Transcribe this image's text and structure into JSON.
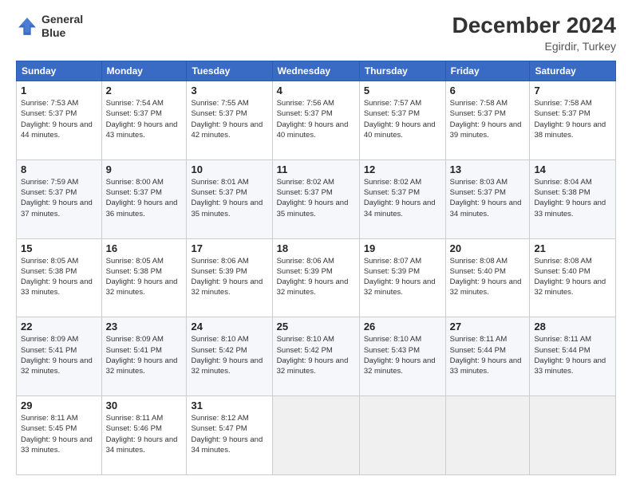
{
  "logo": {
    "line1": "General",
    "line2": "Blue"
  },
  "title": "December 2024",
  "location": "Egirdir, Turkey",
  "days_header": [
    "Sunday",
    "Monday",
    "Tuesday",
    "Wednesday",
    "Thursday",
    "Friday",
    "Saturday"
  ],
  "weeks": [
    [
      {
        "day": "1",
        "sunrise": "Sunrise: 7:53 AM",
        "sunset": "Sunset: 5:37 PM",
        "daylight": "Daylight: 9 hours and 44 minutes."
      },
      {
        "day": "2",
        "sunrise": "Sunrise: 7:54 AM",
        "sunset": "Sunset: 5:37 PM",
        "daylight": "Daylight: 9 hours and 43 minutes."
      },
      {
        "day": "3",
        "sunrise": "Sunrise: 7:55 AM",
        "sunset": "Sunset: 5:37 PM",
        "daylight": "Daylight: 9 hours and 42 minutes."
      },
      {
        "day": "4",
        "sunrise": "Sunrise: 7:56 AM",
        "sunset": "Sunset: 5:37 PM",
        "daylight": "Daylight: 9 hours and 40 minutes."
      },
      {
        "day": "5",
        "sunrise": "Sunrise: 7:57 AM",
        "sunset": "Sunset: 5:37 PM",
        "daylight": "Daylight: 9 hours and 40 minutes."
      },
      {
        "day": "6",
        "sunrise": "Sunrise: 7:58 AM",
        "sunset": "Sunset: 5:37 PM",
        "daylight": "Daylight: 9 hours and 39 minutes."
      },
      {
        "day": "7",
        "sunrise": "Sunrise: 7:58 AM",
        "sunset": "Sunset: 5:37 PM",
        "daylight": "Daylight: 9 hours and 38 minutes."
      }
    ],
    [
      {
        "day": "8",
        "sunrise": "Sunrise: 7:59 AM",
        "sunset": "Sunset: 5:37 PM",
        "daylight": "Daylight: 9 hours and 37 minutes."
      },
      {
        "day": "9",
        "sunrise": "Sunrise: 8:00 AM",
        "sunset": "Sunset: 5:37 PM",
        "daylight": "Daylight: 9 hours and 36 minutes."
      },
      {
        "day": "10",
        "sunrise": "Sunrise: 8:01 AM",
        "sunset": "Sunset: 5:37 PM",
        "daylight": "Daylight: 9 hours and 35 minutes."
      },
      {
        "day": "11",
        "sunrise": "Sunrise: 8:02 AM",
        "sunset": "Sunset: 5:37 PM",
        "daylight": "Daylight: 9 hours and 35 minutes."
      },
      {
        "day": "12",
        "sunrise": "Sunrise: 8:02 AM",
        "sunset": "Sunset: 5:37 PM",
        "daylight": "Daylight: 9 hours and 34 minutes."
      },
      {
        "day": "13",
        "sunrise": "Sunrise: 8:03 AM",
        "sunset": "Sunset: 5:37 PM",
        "daylight": "Daylight: 9 hours and 34 minutes."
      },
      {
        "day": "14",
        "sunrise": "Sunrise: 8:04 AM",
        "sunset": "Sunset: 5:38 PM",
        "daylight": "Daylight: 9 hours and 33 minutes."
      }
    ],
    [
      {
        "day": "15",
        "sunrise": "Sunrise: 8:05 AM",
        "sunset": "Sunset: 5:38 PM",
        "daylight": "Daylight: 9 hours and 33 minutes."
      },
      {
        "day": "16",
        "sunrise": "Sunrise: 8:05 AM",
        "sunset": "Sunset: 5:38 PM",
        "daylight": "Daylight: 9 hours and 32 minutes."
      },
      {
        "day": "17",
        "sunrise": "Sunrise: 8:06 AM",
        "sunset": "Sunset: 5:39 PM",
        "daylight": "Daylight: 9 hours and 32 minutes."
      },
      {
        "day": "18",
        "sunrise": "Sunrise: 8:06 AM",
        "sunset": "Sunset: 5:39 PM",
        "daylight": "Daylight: 9 hours and 32 minutes."
      },
      {
        "day": "19",
        "sunrise": "Sunrise: 8:07 AM",
        "sunset": "Sunset: 5:39 PM",
        "daylight": "Daylight: 9 hours and 32 minutes."
      },
      {
        "day": "20",
        "sunrise": "Sunrise: 8:08 AM",
        "sunset": "Sunset: 5:40 PM",
        "daylight": "Daylight: 9 hours and 32 minutes."
      },
      {
        "day": "21",
        "sunrise": "Sunrise: 8:08 AM",
        "sunset": "Sunset: 5:40 PM",
        "daylight": "Daylight: 9 hours and 32 minutes."
      }
    ],
    [
      {
        "day": "22",
        "sunrise": "Sunrise: 8:09 AM",
        "sunset": "Sunset: 5:41 PM",
        "daylight": "Daylight: 9 hours and 32 minutes."
      },
      {
        "day": "23",
        "sunrise": "Sunrise: 8:09 AM",
        "sunset": "Sunset: 5:41 PM",
        "daylight": "Daylight: 9 hours and 32 minutes."
      },
      {
        "day": "24",
        "sunrise": "Sunrise: 8:10 AM",
        "sunset": "Sunset: 5:42 PM",
        "daylight": "Daylight: 9 hours and 32 minutes."
      },
      {
        "day": "25",
        "sunrise": "Sunrise: 8:10 AM",
        "sunset": "Sunset: 5:42 PM",
        "daylight": "Daylight: 9 hours and 32 minutes."
      },
      {
        "day": "26",
        "sunrise": "Sunrise: 8:10 AM",
        "sunset": "Sunset: 5:43 PM",
        "daylight": "Daylight: 9 hours and 32 minutes."
      },
      {
        "day": "27",
        "sunrise": "Sunrise: 8:11 AM",
        "sunset": "Sunset: 5:44 PM",
        "daylight": "Daylight: 9 hours and 33 minutes."
      },
      {
        "day": "28",
        "sunrise": "Sunrise: 8:11 AM",
        "sunset": "Sunset: 5:44 PM",
        "daylight": "Daylight: 9 hours and 33 minutes."
      }
    ],
    [
      {
        "day": "29",
        "sunrise": "Sunrise: 8:11 AM",
        "sunset": "Sunset: 5:45 PM",
        "daylight": "Daylight: 9 hours and 33 minutes."
      },
      {
        "day": "30",
        "sunrise": "Sunrise: 8:11 AM",
        "sunset": "Sunset: 5:46 PM",
        "daylight": "Daylight: 9 hours and 34 minutes."
      },
      {
        "day": "31",
        "sunrise": "Sunrise: 8:12 AM",
        "sunset": "Sunset: 5:47 PM",
        "daylight": "Daylight: 9 hours and 34 minutes."
      },
      null,
      null,
      null,
      null
    ]
  ]
}
